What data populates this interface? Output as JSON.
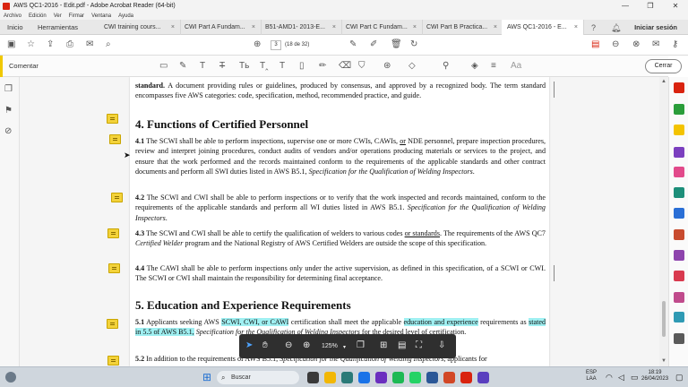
{
  "window": {
    "title": "AWS QC1-2016 - Edit.pdf - Adobe Acrobat Reader (64-bit)"
  },
  "menu": [
    "Archivo",
    "Edición",
    "Ver",
    "Firmar",
    "Ventana",
    "Ayuda"
  ],
  "tabs": {
    "home": "Inicio",
    "tools": "Herramientas",
    "docs": [
      "CWI training cours...",
      "CWI Part A Fundam...",
      "B51-AMD1- 2013-E...",
      "CWI Part C Fundam...",
      "CWI Part B Practica...",
      "AWS QC1-2016 - E..."
    ],
    "close_glyph": "×",
    "sign_in": "Iniciar sesión"
  },
  "toolbar": {
    "page_current": "3",
    "page_total_text": "(18 de 32)"
  },
  "comment_bar": {
    "label": "Comentar",
    "close_button": "Cerrar",
    "tools": [
      "sticky-note-icon",
      "highlight-pen-icon",
      "text-tool-icon",
      "strikethrough-icon",
      "replace-text-icon",
      "insert-text-icon",
      "text-box-icon",
      "pencil-icon",
      "eraser-icon",
      "stamp-icon",
      "attach-icon",
      "shapes-icon",
      "pin-icon",
      "fill-icon",
      "font-size-icon"
    ]
  },
  "document": {
    "intro": {
      "bold": "standard.",
      "text": " A document providing rules or guidelines, produced by consensus, and approved by a recognized body. The term standard encompasses five AWS categories: code, specification, method, recommended practice, and guide."
    },
    "section4_title": "4. Functions of Certified Personnel",
    "p41_num": "4.1",
    "p41_a": " The SCWI shall be able to perform inspections, supervise one or more CWIs, CAWIs, ",
    "p41_or": "or",
    "p41_b": " NDE personnel, prepare inspection procedures, review and interpret joining procedures, conduct audits of vendors and/or operations producing materials or services to the project, and ensure that the work performed and the records maintained conform to the requirements of the applicable standards and other contract documents and perform all SWI duties listed in AWS B5.1, ",
    "p41_italic": "Specification for the Qualification of Welding Inspectors",
    "p41_end": ".",
    "p42_num": "4.2",
    "p42_a": " The SCWI and CWI shall be able to perform inspections or to verify that the work inspected and records maintained, conform to the requirements of the applicable standards and perform all WI duties listed in AWS B5.1. ",
    "p42_italic": "Specification for the Qualification of Welding Inspectors",
    "p42_end": ".",
    "p43_num": "4.3",
    "p43_a": " The SCWI and CWI shall be able to certify the qualification of welders to various codes ",
    "p43_or": "or standards",
    "p43_b": ". The requirements of the AWS QC7 ",
    "p43_italic": "Certified Welder",
    "p43_c": " program and the National Registry of AWS Certified Welders are outside the scope of this specification.",
    "p44_num": "4.4",
    "p44_text": " The CAWI shall be able to perform inspections only under the active supervision, as defined in this specification, of a SCWI or CWI. The SCWI or CWI shall maintain the responsibility for determining final acceptance.",
    "section5_title": "5. Education and Experience Requirements",
    "p51_num": "5.1",
    "p51_a": " Applicants seeking AWS ",
    "p51_hl1": "SCWI, CWI, or CAWI",
    "p51_b": " certification shall meet the applicable ",
    "p51_hl2": "education and experience",
    "p51_c": " requirements as ",
    "p51_hl3": "stated in 5.5 of AWS B5.1,",
    "p51_d": " ",
    "p51_italic": "Specification for the Qualification of Welding Inspectors",
    "p51_e": " for the desired level of certification.",
    "p52_num": "5.2",
    "p52_a": " In addition to the requirements of AWS B5.1, ",
    "p52_italic": "Specification for the Qualification of Welding Inspectors",
    "p52_b": ", applicants for"
  },
  "floating_toolbar": {
    "zoom": "125%"
  },
  "taskbar": {
    "search": "Buscar",
    "lang_1": "ESP",
    "lang_2": "LAA",
    "time": "18:19",
    "date": "26/04/2023"
  },
  "colors": {
    "accent_comment": "#f0c800",
    "note_yellow": "#f3d23a",
    "highlight_cyan": "#9ff0f2"
  }
}
